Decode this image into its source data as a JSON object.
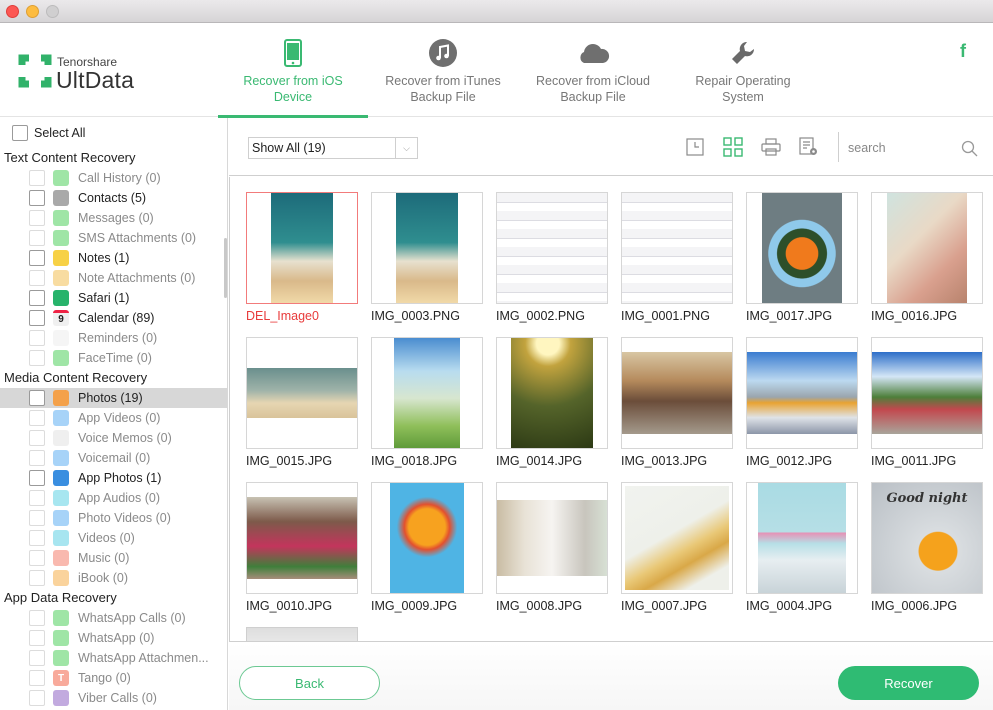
{
  "window": {
    "buttons": [
      "close",
      "minimize",
      "zoom"
    ]
  },
  "brand": {
    "company": "Tenorshare",
    "product": "UltData",
    "logo_icon": "lifebuoy-cross-icon"
  },
  "tabs": [
    {
      "label_line1": "Recover from iOS",
      "label_line2": "Device",
      "icon": "phone-icon",
      "active": true
    },
    {
      "label_line1": "Recover from iTunes",
      "label_line2": "Backup File",
      "icon": "itunes-music-icon",
      "active": false
    },
    {
      "label_line1": "Recover from iCloud",
      "label_line2": "Backup File",
      "icon": "cloud-icon",
      "active": false
    },
    {
      "label_line1": "Repair Operating",
      "label_line2": "System",
      "icon": "wrench-icon",
      "active": false
    }
  ],
  "social": {
    "facebook": "f"
  },
  "sidebar": {
    "select_all": "Select All",
    "sections": [
      {
        "title": "Text Content Recovery",
        "items": [
          {
            "label": "Call History (0)",
            "icon": "phone-icon",
            "color": "#5fd36b",
            "enabled": false
          },
          {
            "label": "Contacts (5)",
            "icon": "contacts-icon",
            "color": "#a9a9a9",
            "enabled": true
          },
          {
            "label": "Messages (0)",
            "icon": "message-icon",
            "color": "#5fd36b",
            "enabled": false
          },
          {
            "label": "SMS Attachments (0)",
            "icon": "paperclip-icon",
            "color": "#5fd36b",
            "enabled": false
          },
          {
            "label": "Notes (1)",
            "icon": "notes-icon",
            "color": "#f7d146",
            "enabled": true
          },
          {
            "label": "Note Attachments (0)",
            "icon": "paperclip-icon",
            "color": "#f3c563",
            "enabled": false
          },
          {
            "label": "Safari (1)",
            "icon": "compass-icon",
            "color": "#27b36b",
            "enabled": true
          },
          {
            "label": "Calendar (89)",
            "icon": "calendar-icon",
            "color": "#f0f0f0",
            "enabled": true,
            "glyph": "9"
          },
          {
            "label": "Reminders (0)",
            "icon": "reminders-icon",
            "color": "#eeeeee",
            "enabled": false
          },
          {
            "label": "FaceTime (0)",
            "icon": "video-camera-icon",
            "color": "#5fd36b",
            "enabled": false
          }
        ]
      },
      {
        "title": "Media Content Recovery",
        "items": [
          {
            "label": "Photos (19)",
            "icon": "photos-flower-icon",
            "color": "#f4a14a",
            "enabled": true,
            "selected": true
          },
          {
            "label": "App Videos (0)",
            "icon": "clapper-icon",
            "color": "#6cb6f3",
            "enabled": false
          },
          {
            "label": "Voice Memos (0)",
            "icon": "waveform-icon",
            "color": "#e5e5e5",
            "enabled": false
          },
          {
            "label": "Voicemail (0)",
            "icon": "voicemail-icon",
            "color": "#6cb6f3",
            "enabled": false
          },
          {
            "label": "App Photos (1)",
            "icon": "landscape-icon",
            "color": "#3a8ee0",
            "enabled": true
          },
          {
            "label": "App Audios (0)",
            "icon": "microphone-icon",
            "color": "#6cd6e6",
            "enabled": false
          },
          {
            "label": "Photo Videos (0)",
            "icon": "photo-video-icon",
            "color": "#6cb6f3",
            "enabled": false
          },
          {
            "label": "Videos (0)",
            "icon": "clapperboard-icon",
            "color": "#6cd3e6",
            "enabled": false
          },
          {
            "label": "Music (0)",
            "icon": "music-note-icon",
            "color": "#f58b7a",
            "enabled": false
          },
          {
            "label": "iBook (0)",
            "icon": "book-icon",
            "color": "#f7b55a",
            "enabled": false
          }
        ]
      },
      {
        "title": "App Data Recovery",
        "items": [
          {
            "label": "WhatsApp Calls (0)",
            "icon": "phone-icon",
            "color": "#5fd36b",
            "enabled": false
          },
          {
            "label": "WhatsApp (0)",
            "icon": "whatsapp-icon",
            "color": "#5fd36b",
            "enabled": false
          },
          {
            "label": "WhatsApp Attachmen...",
            "icon": "paperclip-icon",
            "color": "#5fd36b",
            "enabled": false
          },
          {
            "label": "Tango (0)",
            "icon": "tango-icon",
            "color": "#f5725a",
            "enabled": false,
            "glyph": "T"
          },
          {
            "label": "Viber Calls (0)",
            "icon": "viber-icon",
            "color": "#9a72c9",
            "enabled": false
          }
        ]
      }
    ]
  },
  "toolbar": {
    "filter_value": "Show All (19)",
    "icons": [
      "timeline-view-icon",
      "grid-view-icon",
      "print-icon",
      "export-settings-icon"
    ],
    "search_placeholder": "search"
  },
  "grid": {
    "files": [
      {
        "name": "DEL_Image0",
        "deleted": true,
        "kind": "homescreen"
      },
      {
        "name": "IMG_0003.PNG",
        "kind": "homescreen"
      },
      {
        "name": "IMG_0002.PNG",
        "kind": "settings"
      },
      {
        "name": "IMG_0001.PNG",
        "kind": "settings"
      },
      {
        "name": "IMG_0017.JPG",
        "kind": "flowers-orange"
      },
      {
        "name": "IMG_0016.JPG",
        "kind": "illustration-girl"
      },
      {
        "name": "IMG_0015.JPG",
        "kind": "couple-beach"
      },
      {
        "name": "IMG_0018.JPG",
        "kind": "anime-girl"
      },
      {
        "name": "IMG_0014.JPG",
        "kind": "leaf-sunlight"
      },
      {
        "name": "IMG_0013.JPG",
        "kind": "street-rain"
      },
      {
        "name": "IMG_0012.JPG",
        "kind": "can-city"
      },
      {
        "name": "IMG_0011.JPG",
        "kind": "pub-flowers"
      },
      {
        "name": "IMG_0010.JPG",
        "kind": "flower-house"
      },
      {
        "name": "IMG_0009.JPG",
        "kind": "citrus-balloons"
      },
      {
        "name": "IMG_0008.JPG",
        "kind": "pencil-cup"
      },
      {
        "name": "IMG_0007.JPG",
        "kind": "corn-morning"
      },
      {
        "name": "IMG_0004.JPG",
        "kind": "carnations-vase"
      },
      {
        "name": "IMG_0006.JPG",
        "kind": "goodnight-clock",
        "caption": "Good night"
      }
    ]
  },
  "footer": {
    "back_label": "Back",
    "recover_label": "Recover"
  },
  "colors": {
    "accent": "#3ab972",
    "deleted": "#e83b3b"
  }
}
